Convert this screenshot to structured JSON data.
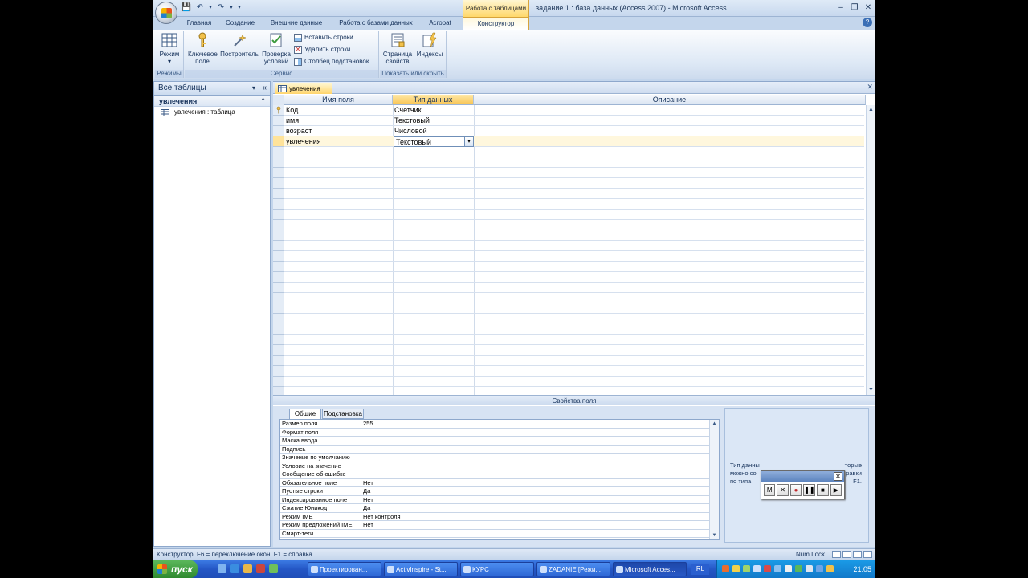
{
  "window": {
    "title": "задание 1 : база данных (Access 2007) - Microsoft Access",
    "context_group": "Работа с таблицами"
  },
  "ribbon_tabs": [
    "Главная",
    "Создание",
    "Внешние данные",
    "Работа с базами данных",
    "Acrobat",
    "Конструктор"
  ],
  "active_tab": "Конструктор",
  "ribbon": {
    "views": {
      "label": "Режим",
      "group": "Режимы"
    },
    "service": {
      "group": "Сервис",
      "key_field": "Ключевое поле",
      "builder": "Построитель",
      "test_rules": "Проверка условий",
      "insert_rows": "Вставить строки",
      "delete_rows": "Удалить строки",
      "lookup_column": "Столбец подстановок"
    },
    "showhide": {
      "group": "Показать или скрыть",
      "property_sheet": "Страница свойств",
      "indexes": "Индексы"
    }
  },
  "nav": {
    "header": "Все таблицы",
    "group": "увлечения",
    "item": "увлечения : таблица"
  },
  "document": {
    "tab_label": "увлечения",
    "columns": [
      "Имя поля",
      "Тип данных",
      "Описание"
    ],
    "rows": [
      {
        "name": "Код",
        "type": "Счетчик",
        "description": ""
      },
      {
        "name": "имя",
        "type": "Текстовый",
        "description": ""
      },
      {
        "name": "возраст",
        "type": "Числовой",
        "description": ""
      },
      {
        "name": "увлечения",
        "type": "Текстовый",
        "description": ""
      }
    ]
  },
  "properties": {
    "title": "Свойства поля",
    "tabs": [
      "Общие",
      "Подстановка"
    ],
    "rows": [
      {
        "name": "Размер поля",
        "value": "255"
      },
      {
        "name": "Формат поля",
        "value": ""
      },
      {
        "name": "Маска ввода",
        "value": ""
      },
      {
        "name": "Подпись",
        "value": ""
      },
      {
        "name": "Значение по умолчанию",
        "value": ""
      },
      {
        "name": "Условие на значение",
        "value": ""
      },
      {
        "name": "Сообщение об ошибке",
        "value": ""
      },
      {
        "name": "Обязательное поле",
        "value": "Нет"
      },
      {
        "name": "Пустые строки",
        "value": "Да"
      },
      {
        "name": "Индексированное поле",
        "value": "Нет"
      },
      {
        "name": "Сжатие Юникод",
        "value": "Да"
      },
      {
        "name": "Режим IME",
        "value": "Нет контроля"
      },
      {
        "name": "Режим предложений IME",
        "value": "Нет"
      },
      {
        "name": "Смарт-теги",
        "value": ""
      }
    ],
    "hint_left": [
      "Тип данны",
      "можно со",
      "по типа"
    ],
    "hint_right": [
      "торые",
      "равки",
      "F1."
    ]
  },
  "recorder": {
    "buttons": [
      "M",
      "✕",
      "●",
      "❚❚",
      "■",
      "▶"
    ]
  },
  "status": {
    "left": "Конструктор.  F6 = переключение окон.  F1 = справка.",
    "numlock": "Num Lock"
  },
  "taskbar": {
    "start": "пуск",
    "buttons": [
      "Проектирован...",
      "ActivInspire - St...",
      "КУРС",
      "ZADANIE [Режи...",
      "Microsoft Acces..."
    ],
    "lang": "RL",
    "clock": "21:05"
  },
  "colors": {
    "accent": "#ffd56c",
    "frame": "#c4d6ec",
    "taskbar": "#2456c5"
  }
}
